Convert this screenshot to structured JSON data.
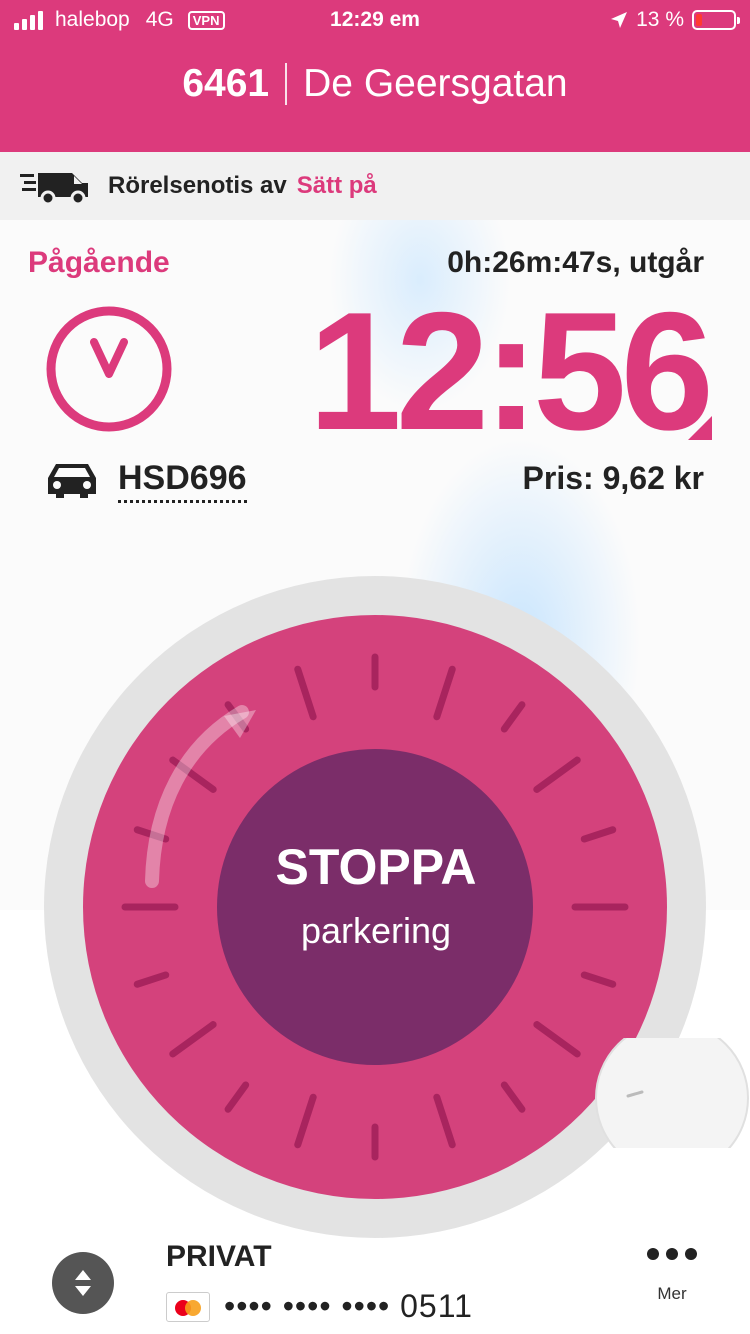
{
  "status_bar": {
    "carrier": "halebop",
    "network": "4G",
    "vpn": "VPN",
    "time": "12:29 em",
    "battery": "13 %"
  },
  "header": {
    "zone_number": "6461",
    "zone_name": "De Geersgatan"
  },
  "notice": {
    "label": "Rörelsenotis av",
    "action": "Sätt på"
  },
  "parking": {
    "status": "Pågående",
    "remaining": "0h:26m:47s, utgår",
    "end_time": "12:56",
    "plate": "HSD696",
    "price": "Pris: 9,62 kr"
  },
  "stop_button": {
    "title": "STOPPA",
    "subtitle": "parkering"
  },
  "payment": {
    "account": "PRIVAT",
    "card_masked": "•••• •••• •••• 0511",
    "more_label": "Mer"
  },
  "colors": {
    "brand": "#dc3a7c",
    "dial": "#d4427c",
    "center": "#7b2d69",
    "ring": "#e3e3e3"
  }
}
